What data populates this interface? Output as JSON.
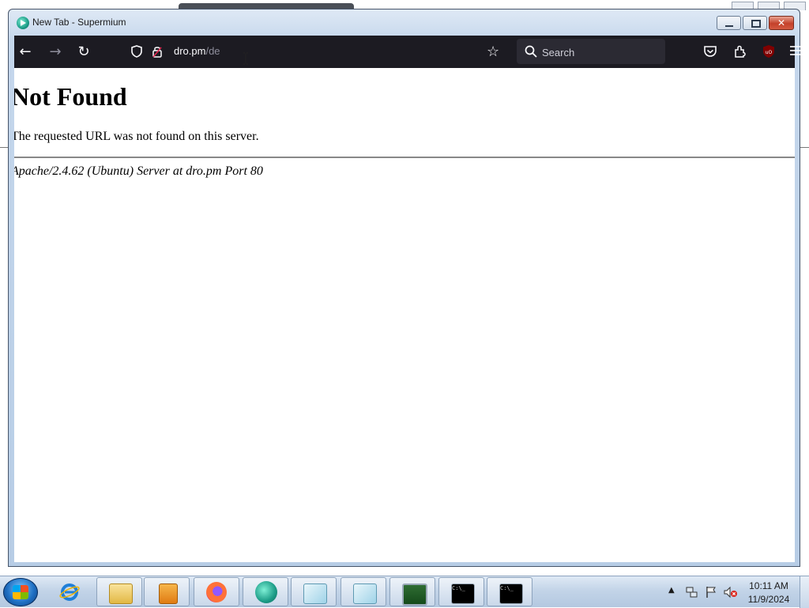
{
  "window": {
    "title": "New Tab - Supermium"
  },
  "toolbar": {
    "url_host": "dro.pm",
    "url_path": "/de",
    "search_placeholder": "Search"
  },
  "page": {
    "heading": "Not Found",
    "message": "The requested URL was not found on this server.",
    "footer": "Apache/2.4.62 (Ubuntu) Server at dro.pm Port 80"
  },
  "taskbar": {
    "apps": [
      {
        "name": "internet-explorer"
      },
      {
        "name": "file-explorer"
      },
      {
        "name": "media-player"
      },
      {
        "name": "firefox"
      },
      {
        "name": "supermium"
      },
      {
        "name": "notepad-1"
      },
      {
        "name": "notepad-2"
      },
      {
        "name": "task-manager"
      },
      {
        "name": "command-prompt-1"
      },
      {
        "name": "command-prompt-2"
      }
    ],
    "clock_time": "10:11 AM",
    "clock_date": "11/9/2024"
  },
  "colors": {
    "toolbar_bg": "#1c1b22",
    "searchbar_bg": "#2b2a33",
    "close_button": "#c4412a",
    "taskbar": "#c3d4e8"
  }
}
